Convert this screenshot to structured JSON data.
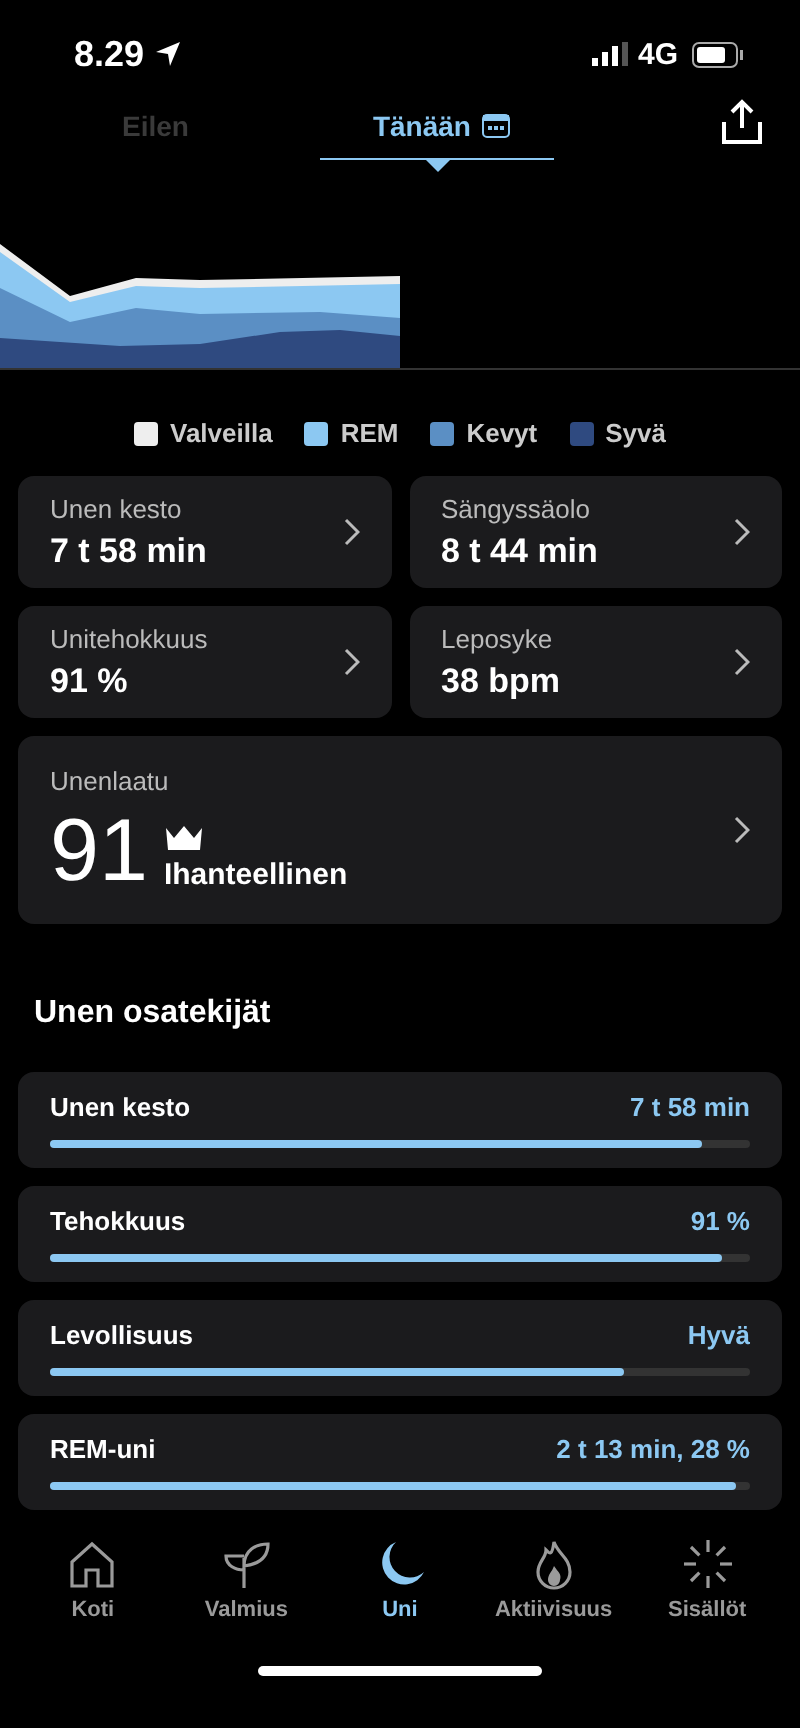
{
  "status_bar": {
    "time": "8.29",
    "network": "4G"
  },
  "day_tabs": [
    {
      "label": "Eilen",
      "selected": false
    },
    {
      "label": "Tänään",
      "selected": true
    }
  ],
  "legend": [
    {
      "label": "Valveilla",
      "color": "#eeeeee"
    },
    {
      "label": "REM",
      "color": "#8cc8f2"
    },
    {
      "label": "Kevyt",
      "color": "#5b8fc4"
    },
    {
      "label": "Syvä",
      "color": "#2f4a80"
    }
  ],
  "metrics": [
    {
      "label": "Unen kesto",
      "value": "7 t 58 min"
    },
    {
      "label": "Sängyssäolo",
      "value": "8 t 44 min"
    },
    {
      "label": "Unitehokkuus",
      "value": "91 %"
    },
    {
      "label": "Leposyke",
      "value": "38 bpm"
    }
  ],
  "quality": {
    "label": "Unenlaatu",
    "score": "91",
    "rating": "Ihanteellinen"
  },
  "contributors_title": "Unen osatekijät",
  "contributors": [
    {
      "label": "Unen kesto",
      "value": "7 t 58 min",
      "level": 0.93
    },
    {
      "label": "Tehokkuus",
      "value": "91 %",
      "level": 0.96
    },
    {
      "label": "Levollisuus",
      "value": "Hyvä",
      "level": 0.82
    },
    {
      "label": "REM-uni",
      "value": "2 t 13 min, 28 %",
      "level": 0.98
    }
  ],
  "nav": [
    {
      "label": "Koti",
      "selected": false
    },
    {
      "label": "Valmius",
      "selected": false
    },
    {
      "label": "Uni",
      "selected": true
    },
    {
      "label": "Aktiivisuus",
      "selected": false
    },
    {
      "label": "Sisällöt",
      "selected": false
    }
  ]
}
